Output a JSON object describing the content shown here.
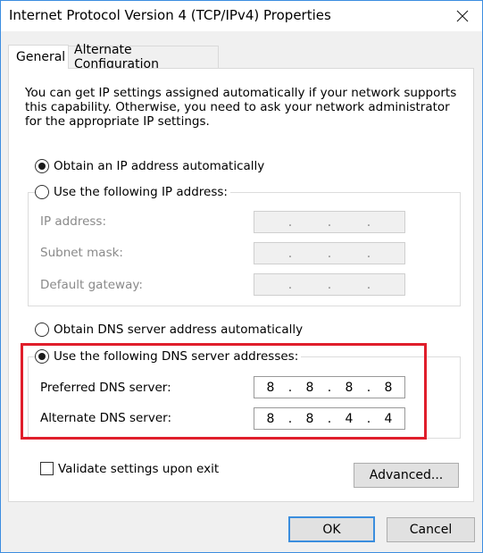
{
  "window": {
    "title": "Internet Protocol Version 4 (TCP/IPv4) Properties"
  },
  "tabs": [
    {
      "label": "General"
    },
    {
      "label": "Alternate Configuration"
    }
  ],
  "description": "You can get IP settings assigned automatically if your network supports this capability. Otherwise, you need to ask your network administrator for the appropriate IP settings.",
  "ip": {
    "auto_label": "Obtain an IP address automatically",
    "manual_label": "Use the following IP address:",
    "selected": "auto",
    "fields": [
      {
        "label": "IP address:",
        "value": [
          "",
          "",
          "",
          ""
        ]
      },
      {
        "label": "Subnet mask:",
        "value": [
          "",
          "",
          "",
          ""
        ]
      },
      {
        "label": "Default gateway:",
        "value": [
          "",
          "",
          "",
          ""
        ]
      }
    ]
  },
  "dns": {
    "auto_label": "Obtain DNS server address automatically",
    "manual_label": "Use the following DNS server addresses:",
    "selected": "manual",
    "preferred": {
      "label": "Preferred DNS server:",
      "value": [
        "8",
        "8",
        "8",
        "8"
      ]
    },
    "alternate": {
      "label": "Alternate DNS server:",
      "value": [
        "8",
        "8",
        "4",
        "4"
      ]
    }
  },
  "validate_label": "Validate settings upon exit",
  "validate_checked": false,
  "buttons": {
    "advanced": "Advanced...",
    "ok": "OK",
    "cancel": "Cancel"
  },
  "colors": {
    "highlight": "#e01e2b",
    "accent": "#3b8ede"
  }
}
